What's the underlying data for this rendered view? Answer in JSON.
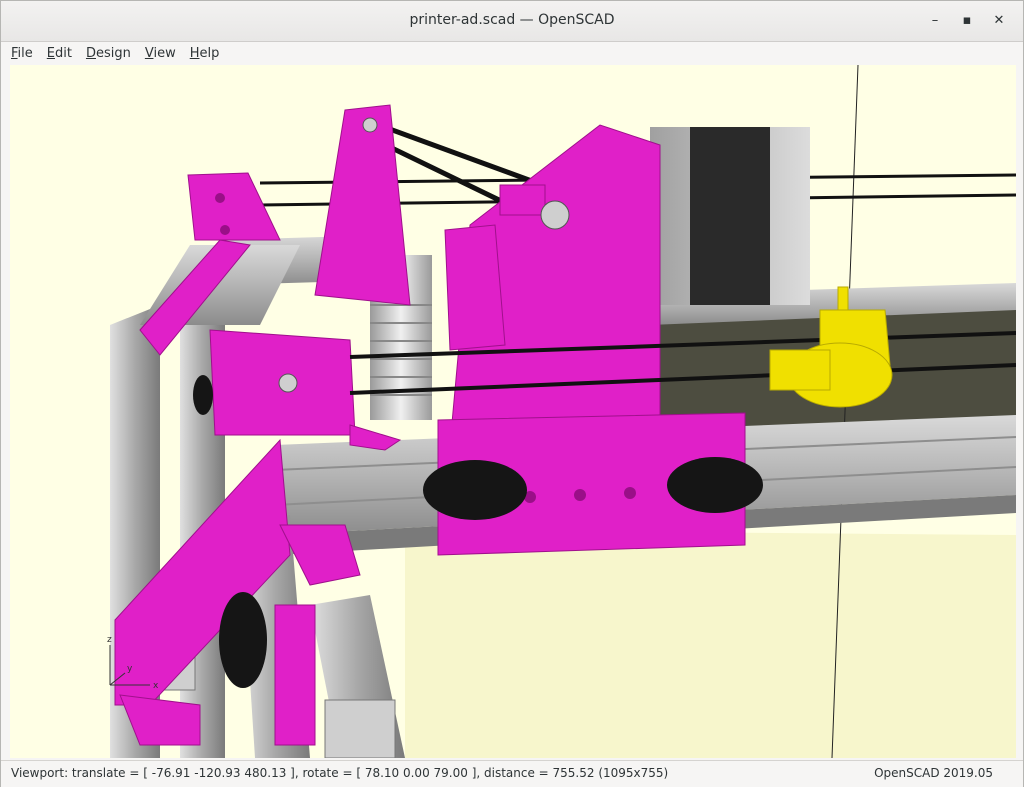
{
  "window": {
    "title": "printer-ad.scad — OpenSCAD",
    "minimize_glyph": "–",
    "maximize_glyph": "▪",
    "close_glyph": "✕"
  },
  "menubar": {
    "items": [
      {
        "label": "File"
      },
      {
        "label": "Edit"
      },
      {
        "label": "Design"
      },
      {
        "label": "View"
      },
      {
        "label": "Help"
      }
    ]
  },
  "viewport": {
    "background_color": "#ffffe5",
    "part_color": "#e020c8",
    "highlight_color": "#f0e000",
    "axes": {
      "z": "z",
      "x": "x",
      "y": "y"
    }
  },
  "statusbar": {
    "viewport_info": "Viewport: translate = [ -76.91 -120.93 480.13 ], rotate = [ 78.10 0.00 79.00 ], distance = 755.52 (1095x755)",
    "version": "OpenSCAD 2019.05"
  }
}
